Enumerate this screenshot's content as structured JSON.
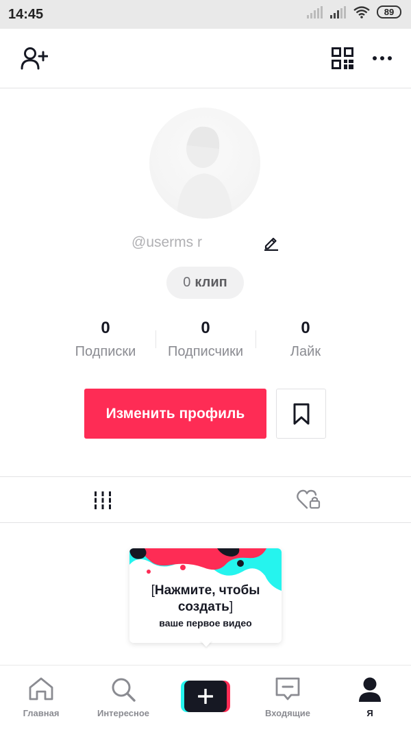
{
  "status_bar": {
    "time": "14:45",
    "battery": "89"
  },
  "top_bar": {
    "add_user_icon": "person-plus-icon",
    "qr_icon": "qr-code-icon",
    "more_icon": "more-horizontal-icon"
  },
  "profile": {
    "username": "@userms r",
    "clips_count": "0",
    "clips_label": "клип",
    "stats": [
      {
        "value": "0",
        "label": "Подписки"
      },
      {
        "value": "0",
        "label": "Подписчики"
      },
      {
        "value": "0",
        "label": "Лайк"
      }
    ],
    "edit_profile_label": "Изменить профиль"
  },
  "tabs": {
    "videos_icon": "grid-bars-icon",
    "liked_icon": "locked-heart-icon"
  },
  "promo_card": {
    "title_line1": "Нажмите, чтобы",
    "title_line2": "создать",
    "bracket_open": "[",
    "bracket_close": "]",
    "subtitle": "ваше первое видео"
  },
  "bottom_nav": {
    "items": [
      {
        "label": "Главная",
        "icon": "home-icon"
      },
      {
        "label": "Интересное",
        "icon": "search-icon"
      },
      {
        "label": "",
        "icon": "plus-icon"
      },
      {
        "label": "Входящие",
        "icon": "inbox-icon"
      },
      {
        "label": "Я",
        "icon": "profile-icon"
      }
    ],
    "active_index": 4
  },
  "colors": {
    "accent": "#fe2c55",
    "cyan": "#25f4ee",
    "dark": "#161823",
    "muted": "#8a8b91"
  }
}
